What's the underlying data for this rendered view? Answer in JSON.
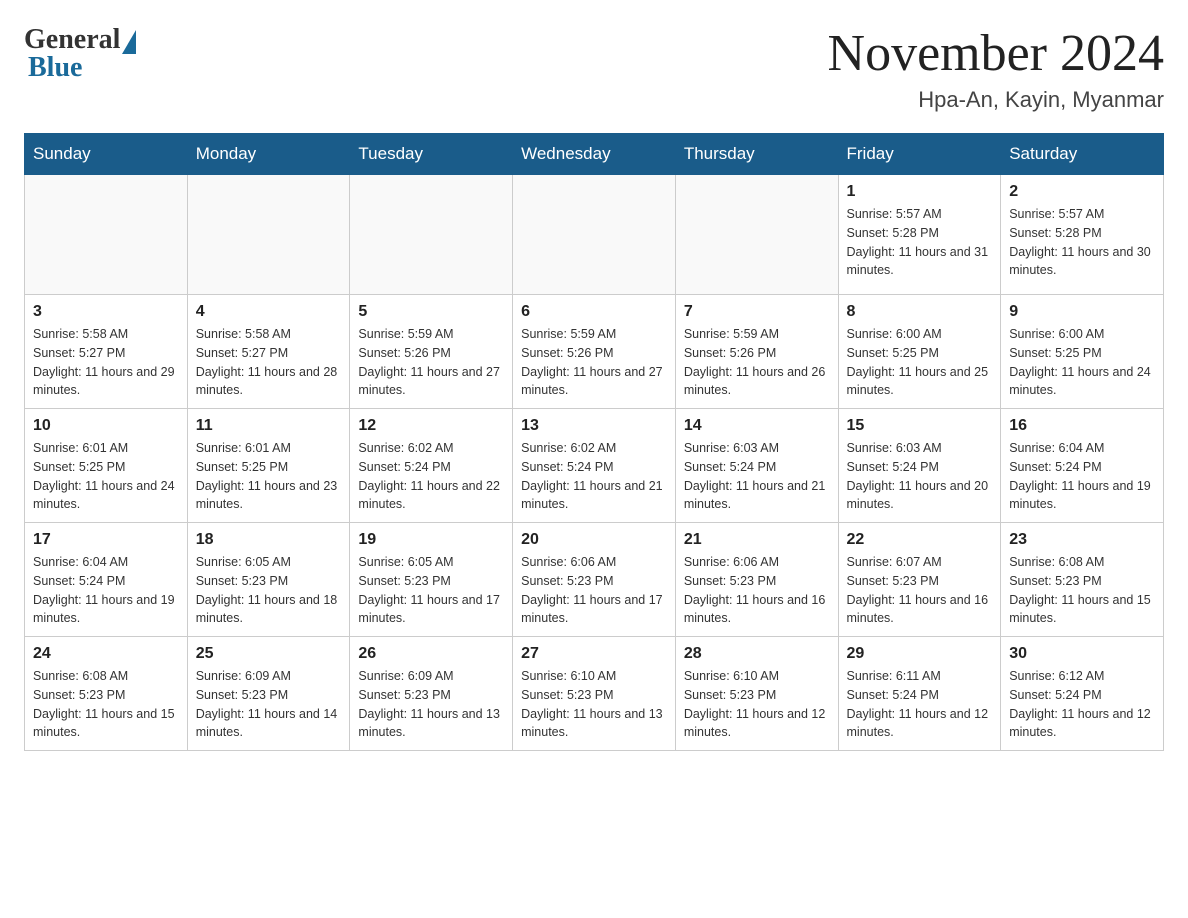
{
  "header": {
    "logo_general": "General",
    "logo_blue": "Blue",
    "month_title": "November 2024",
    "location": "Hpa-An, Kayin, Myanmar"
  },
  "days_of_week": [
    "Sunday",
    "Monday",
    "Tuesday",
    "Wednesday",
    "Thursday",
    "Friday",
    "Saturday"
  ],
  "weeks": [
    [
      {
        "day": "",
        "info": ""
      },
      {
        "day": "",
        "info": ""
      },
      {
        "day": "",
        "info": ""
      },
      {
        "day": "",
        "info": ""
      },
      {
        "day": "",
        "info": ""
      },
      {
        "day": "1",
        "info": "Sunrise: 5:57 AM\nSunset: 5:28 PM\nDaylight: 11 hours and 31 minutes."
      },
      {
        "day": "2",
        "info": "Sunrise: 5:57 AM\nSunset: 5:28 PM\nDaylight: 11 hours and 30 minutes."
      }
    ],
    [
      {
        "day": "3",
        "info": "Sunrise: 5:58 AM\nSunset: 5:27 PM\nDaylight: 11 hours and 29 minutes."
      },
      {
        "day": "4",
        "info": "Sunrise: 5:58 AM\nSunset: 5:27 PM\nDaylight: 11 hours and 28 minutes."
      },
      {
        "day": "5",
        "info": "Sunrise: 5:59 AM\nSunset: 5:26 PM\nDaylight: 11 hours and 27 minutes."
      },
      {
        "day": "6",
        "info": "Sunrise: 5:59 AM\nSunset: 5:26 PM\nDaylight: 11 hours and 27 minutes."
      },
      {
        "day": "7",
        "info": "Sunrise: 5:59 AM\nSunset: 5:26 PM\nDaylight: 11 hours and 26 minutes."
      },
      {
        "day": "8",
        "info": "Sunrise: 6:00 AM\nSunset: 5:25 PM\nDaylight: 11 hours and 25 minutes."
      },
      {
        "day": "9",
        "info": "Sunrise: 6:00 AM\nSunset: 5:25 PM\nDaylight: 11 hours and 24 minutes."
      }
    ],
    [
      {
        "day": "10",
        "info": "Sunrise: 6:01 AM\nSunset: 5:25 PM\nDaylight: 11 hours and 24 minutes."
      },
      {
        "day": "11",
        "info": "Sunrise: 6:01 AM\nSunset: 5:25 PM\nDaylight: 11 hours and 23 minutes."
      },
      {
        "day": "12",
        "info": "Sunrise: 6:02 AM\nSunset: 5:24 PM\nDaylight: 11 hours and 22 minutes."
      },
      {
        "day": "13",
        "info": "Sunrise: 6:02 AM\nSunset: 5:24 PM\nDaylight: 11 hours and 21 minutes."
      },
      {
        "day": "14",
        "info": "Sunrise: 6:03 AM\nSunset: 5:24 PM\nDaylight: 11 hours and 21 minutes."
      },
      {
        "day": "15",
        "info": "Sunrise: 6:03 AM\nSunset: 5:24 PM\nDaylight: 11 hours and 20 minutes."
      },
      {
        "day": "16",
        "info": "Sunrise: 6:04 AM\nSunset: 5:24 PM\nDaylight: 11 hours and 19 minutes."
      }
    ],
    [
      {
        "day": "17",
        "info": "Sunrise: 6:04 AM\nSunset: 5:24 PM\nDaylight: 11 hours and 19 minutes."
      },
      {
        "day": "18",
        "info": "Sunrise: 6:05 AM\nSunset: 5:23 PM\nDaylight: 11 hours and 18 minutes."
      },
      {
        "day": "19",
        "info": "Sunrise: 6:05 AM\nSunset: 5:23 PM\nDaylight: 11 hours and 17 minutes."
      },
      {
        "day": "20",
        "info": "Sunrise: 6:06 AM\nSunset: 5:23 PM\nDaylight: 11 hours and 17 minutes."
      },
      {
        "day": "21",
        "info": "Sunrise: 6:06 AM\nSunset: 5:23 PM\nDaylight: 11 hours and 16 minutes."
      },
      {
        "day": "22",
        "info": "Sunrise: 6:07 AM\nSunset: 5:23 PM\nDaylight: 11 hours and 16 minutes."
      },
      {
        "day": "23",
        "info": "Sunrise: 6:08 AM\nSunset: 5:23 PM\nDaylight: 11 hours and 15 minutes."
      }
    ],
    [
      {
        "day": "24",
        "info": "Sunrise: 6:08 AM\nSunset: 5:23 PM\nDaylight: 11 hours and 15 minutes."
      },
      {
        "day": "25",
        "info": "Sunrise: 6:09 AM\nSunset: 5:23 PM\nDaylight: 11 hours and 14 minutes."
      },
      {
        "day": "26",
        "info": "Sunrise: 6:09 AM\nSunset: 5:23 PM\nDaylight: 11 hours and 13 minutes."
      },
      {
        "day": "27",
        "info": "Sunrise: 6:10 AM\nSunset: 5:23 PM\nDaylight: 11 hours and 13 minutes."
      },
      {
        "day": "28",
        "info": "Sunrise: 6:10 AM\nSunset: 5:23 PM\nDaylight: 11 hours and 12 minutes."
      },
      {
        "day": "29",
        "info": "Sunrise: 6:11 AM\nSunset: 5:24 PM\nDaylight: 11 hours and 12 minutes."
      },
      {
        "day": "30",
        "info": "Sunrise: 6:12 AM\nSunset: 5:24 PM\nDaylight: 11 hours and 12 minutes."
      }
    ]
  ]
}
